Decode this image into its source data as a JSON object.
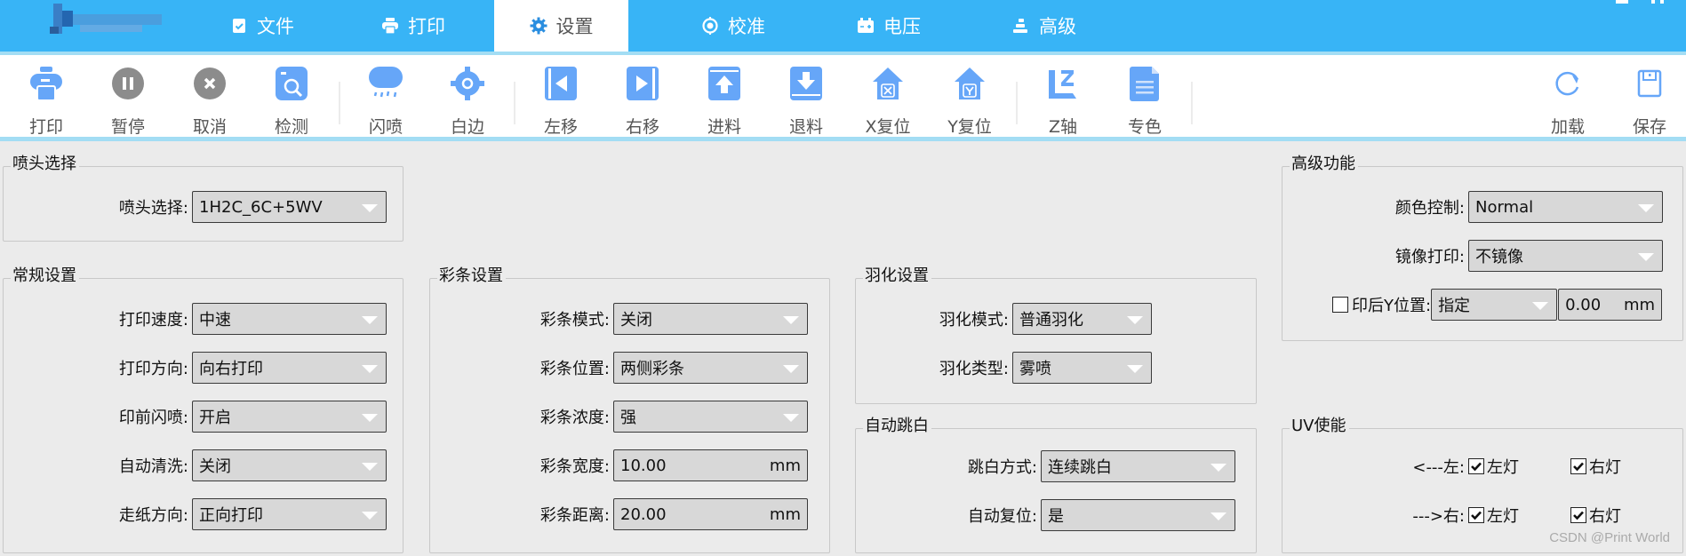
{
  "header": {
    "tabs": [
      {
        "label": "文件",
        "icon": "clipboard-check-icon"
      },
      {
        "label": "打印",
        "icon": "printer-icon"
      },
      {
        "label": "设置",
        "icon": "gear-icon",
        "active": true
      },
      {
        "label": "校准",
        "icon": "target-icon"
      },
      {
        "label": "电压",
        "icon": "battery-icon"
      },
      {
        "label": "高级",
        "icon": "stack-icon"
      }
    ],
    "accent_color": "#38b4f6"
  },
  "toolbar": {
    "buttons": [
      {
        "label": "打印",
        "icon": "printer-icon"
      },
      {
        "label": "暂停",
        "icon": "pause-icon"
      },
      {
        "label": "取消",
        "icon": "cancel-icon"
      },
      {
        "label": "检测",
        "icon": "inspect-icon"
      },
      {
        "label": "闪喷",
        "icon": "spray-icon"
      },
      {
        "label": "白边",
        "icon": "crosshair-icon"
      },
      {
        "label": "左移",
        "icon": "move-left-icon"
      },
      {
        "label": "右移",
        "icon": "move-right-icon"
      },
      {
        "label": "进料",
        "icon": "feed-in-icon"
      },
      {
        "label": "退料",
        "icon": "feed-out-icon"
      },
      {
        "label": "X复位",
        "icon": "home-x-icon"
      },
      {
        "label": "Y复位",
        "icon": "home-y-icon"
      },
      {
        "label": "Z轴",
        "icon": "z-axis-icon"
      },
      {
        "label": "专色",
        "icon": "document-icon"
      },
      {
        "label": "加载",
        "icon": "reload-icon"
      },
      {
        "label": "保存",
        "icon": "save-icon"
      }
    ],
    "icon_color": "#66a6f8"
  },
  "nozzle": {
    "title": "喷头选择",
    "label": "喷头选择:",
    "value": "1H2C_6C+5WV"
  },
  "general": {
    "title": "常规设置",
    "fields": [
      {
        "label": "打印速度:",
        "value": "中速"
      },
      {
        "label": "打印方向:",
        "value": "向右打印"
      },
      {
        "label": "印前闪喷:",
        "value": "开启"
      },
      {
        "label": "自动清洗:",
        "value": "关闭"
      },
      {
        "label": "走纸方向:",
        "value": "正向打印"
      }
    ]
  },
  "colorbar": {
    "title": "彩条设置",
    "fields": [
      {
        "label": "彩条模式:",
        "value": "关闭"
      },
      {
        "label": "彩条位置:",
        "value": "两侧彩条"
      },
      {
        "label": "彩条浓度:",
        "value": "强"
      },
      {
        "label": "彩条宽度:",
        "value": "10.00",
        "unit": "mm"
      },
      {
        "label": "彩条距离:",
        "value": "20.00",
        "unit": "mm"
      }
    ]
  },
  "feather": {
    "title": "羽化设置",
    "fields": [
      {
        "label": "羽化模式:",
        "value": "普通羽化"
      },
      {
        "label": "羽化类型:",
        "value": "雾喷"
      }
    ]
  },
  "autoskip": {
    "title": "自动跳白",
    "fields": [
      {
        "label": "跳白方式:",
        "value": "连续跳白"
      },
      {
        "label": "自动复位:",
        "value": "是"
      }
    ]
  },
  "advanced": {
    "title": "高级功能",
    "color_control_label": "颜色控制:",
    "color_control_value": "Normal",
    "mirror_label": "镜像打印:",
    "mirror_value": "不镜像",
    "post_y_label": "印后Y位置:",
    "post_y_checked": false,
    "post_y_mode": "指定",
    "post_y_value": "0.00",
    "post_y_unit": "mm"
  },
  "uv": {
    "title": "UV使能",
    "rows": [
      {
        "label": "<---左:",
        "left_lamp": "左灯",
        "left_checked": true,
        "right_lamp": "右灯",
        "right_checked": true
      },
      {
        "label": "--->右:",
        "left_lamp": "左灯",
        "left_checked": true,
        "right_lamp": "右灯",
        "right_checked": true
      }
    ]
  },
  "watermark": "CSDN @Print World"
}
